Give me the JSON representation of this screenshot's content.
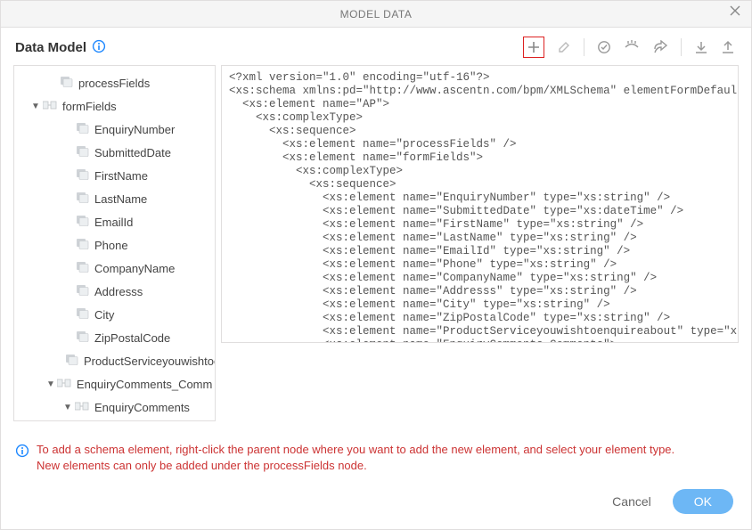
{
  "dialog": {
    "title": "MODEL DATA"
  },
  "header": {
    "label": "Data Model"
  },
  "tree": {
    "items": [
      {
        "label": "processFields",
        "indent": 38,
        "caret": "",
        "kind": "leaf"
      },
      {
        "label": "formFields",
        "indent": 18,
        "caret": "▼",
        "kind": "group"
      },
      {
        "label": "EnquiryNumber",
        "indent": 56,
        "caret": "",
        "kind": "leaf"
      },
      {
        "label": "SubmittedDate",
        "indent": 56,
        "caret": "",
        "kind": "leaf"
      },
      {
        "label": "FirstName",
        "indent": 56,
        "caret": "",
        "kind": "leaf"
      },
      {
        "label": "LastName",
        "indent": 56,
        "caret": "",
        "kind": "leaf"
      },
      {
        "label": "EmailId",
        "indent": 56,
        "caret": "",
        "kind": "leaf"
      },
      {
        "label": "Phone",
        "indent": 56,
        "caret": "",
        "kind": "leaf"
      },
      {
        "label": "CompanyName",
        "indent": 56,
        "caret": "",
        "kind": "leaf"
      },
      {
        "label": "Addresss",
        "indent": 56,
        "caret": "",
        "kind": "leaf"
      },
      {
        "label": "City",
        "indent": 56,
        "caret": "",
        "kind": "leaf"
      },
      {
        "label": "ZipPostalCode",
        "indent": 56,
        "caret": "",
        "kind": "leaf"
      },
      {
        "label": "ProductServiceyouwishtoe",
        "indent": 56,
        "caret": "",
        "kind": "leaf"
      },
      {
        "label": "EnquiryComments_Comm",
        "indent": 36,
        "caret": "▼",
        "kind": "group"
      },
      {
        "label": "EnquiryComments",
        "indent": 54,
        "caret": "▼",
        "kind": "group"
      }
    ]
  },
  "xml": {
    "lines": [
      "<?xml version=\"1.0\" encoding=\"utf-16\"?>",
      "<xs:schema xmlns:pd=\"http://www.ascentn.com/bpm/XMLSchema\" elementFormDefault=\"qu",
      "  <xs:element name=\"AP\">",
      "    <xs:complexType>",
      "      <xs:sequence>",
      "        <xs:element name=\"processFields\" />",
      "        <xs:element name=\"formFields\">",
      "          <xs:complexType>",
      "            <xs:sequence>",
      "              <xs:element name=\"EnquiryNumber\" type=\"xs:string\" />",
      "              <xs:element name=\"SubmittedDate\" type=\"xs:dateTime\" />",
      "              <xs:element name=\"FirstName\" type=\"xs:string\" />",
      "              <xs:element name=\"LastName\" type=\"xs:string\" />",
      "              <xs:element name=\"EmailId\" type=\"xs:string\" />",
      "              <xs:element name=\"Phone\" type=\"xs:string\" />",
      "              <xs:element name=\"CompanyName\" type=\"xs:string\" />",
      "              <xs:element name=\"Addresss\" type=\"xs:string\" />",
      "              <xs:element name=\"City\" type=\"xs:string\" />",
      "              <xs:element name=\"ZipPostalCode\" type=\"xs:string\" />",
      "              <xs:element name=\"ProductServiceyouwishtoenquireabout\" type=\"xs:st",
      "              <xs:element name=\"EnquiryComments Comments\">"
    ]
  },
  "hint": {
    "line1": "To add a schema element, right-click the parent node where you want to add the new element, and select your element type.",
    "line2": "New elements can only be added under the processFields node."
  },
  "footer": {
    "cancel": "Cancel",
    "ok": "OK"
  }
}
